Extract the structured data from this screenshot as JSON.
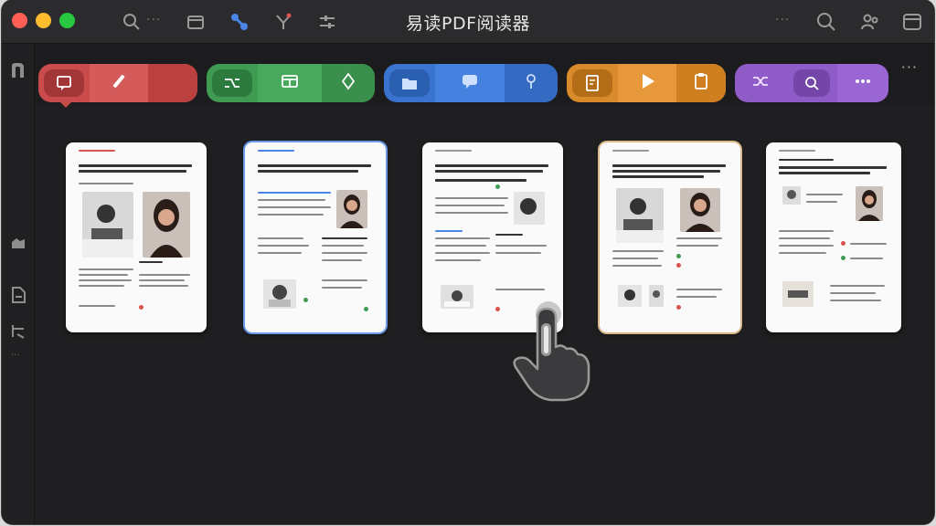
{
  "window": {
    "title": "易读PDF阅读器"
  },
  "colors": {
    "red": "#c94b4b",
    "green": "#3f9a52",
    "blue": "#3a74d0",
    "orange": "#d98a2a",
    "purple": "#8e5bc7"
  },
  "titlebar": {
    "left_icons": [
      "search-icon",
      "calendar-icon",
      "link-icon",
      "filter-icon",
      "adjust-icon"
    ],
    "right_icons": [
      "search-icon",
      "users-icon",
      "window-icon"
    ],
    "dots": "···"
  },
  "sidebar": {
    "icons": [
      "library-icon",
      "cloud-icon",
      "document-icon",
      "hierarchy-icon"
    ],
    "dots": "···"
  },
  "toolbar": {
    "groups": [
      {
        "name": "annotate",
        "icons": [
          "comment-icon",
          "pen-icon"
        ]
      },
      {
        "name": "organize",
        "icons": [
          "split-icon",
          "panel-icon",
          "diamond-icon"
        ]
      },
      {
        "name": "files",
        "icons": [
          "folder-icon",
          "chat-icon",
          "pin-icon"
        ]
      },
      {
        "name": "present",
        "icons": [
          "slides-icon",
          "play-icon",
          "clipboard-icon"
        ]
      },
      {
        "name": "tools",
        "icons": [
          "shuffle-icon",
          "zoom-icon",
          "ellipsis-icon"
        ]
      }
    ],
    "more": "···"
  },
  "pages": [
    {
      "index": 1,
      "state": "normal"
    },
    {
      "index": 2,
      "state": "selected"
    },
    {
      "index": 3,
      "state": "hovered"
    },
    {
      "index": 4,
      "state": "marked"
    },
    {
      "index": 5,
      "state": "normal"
    }
  ]
}
